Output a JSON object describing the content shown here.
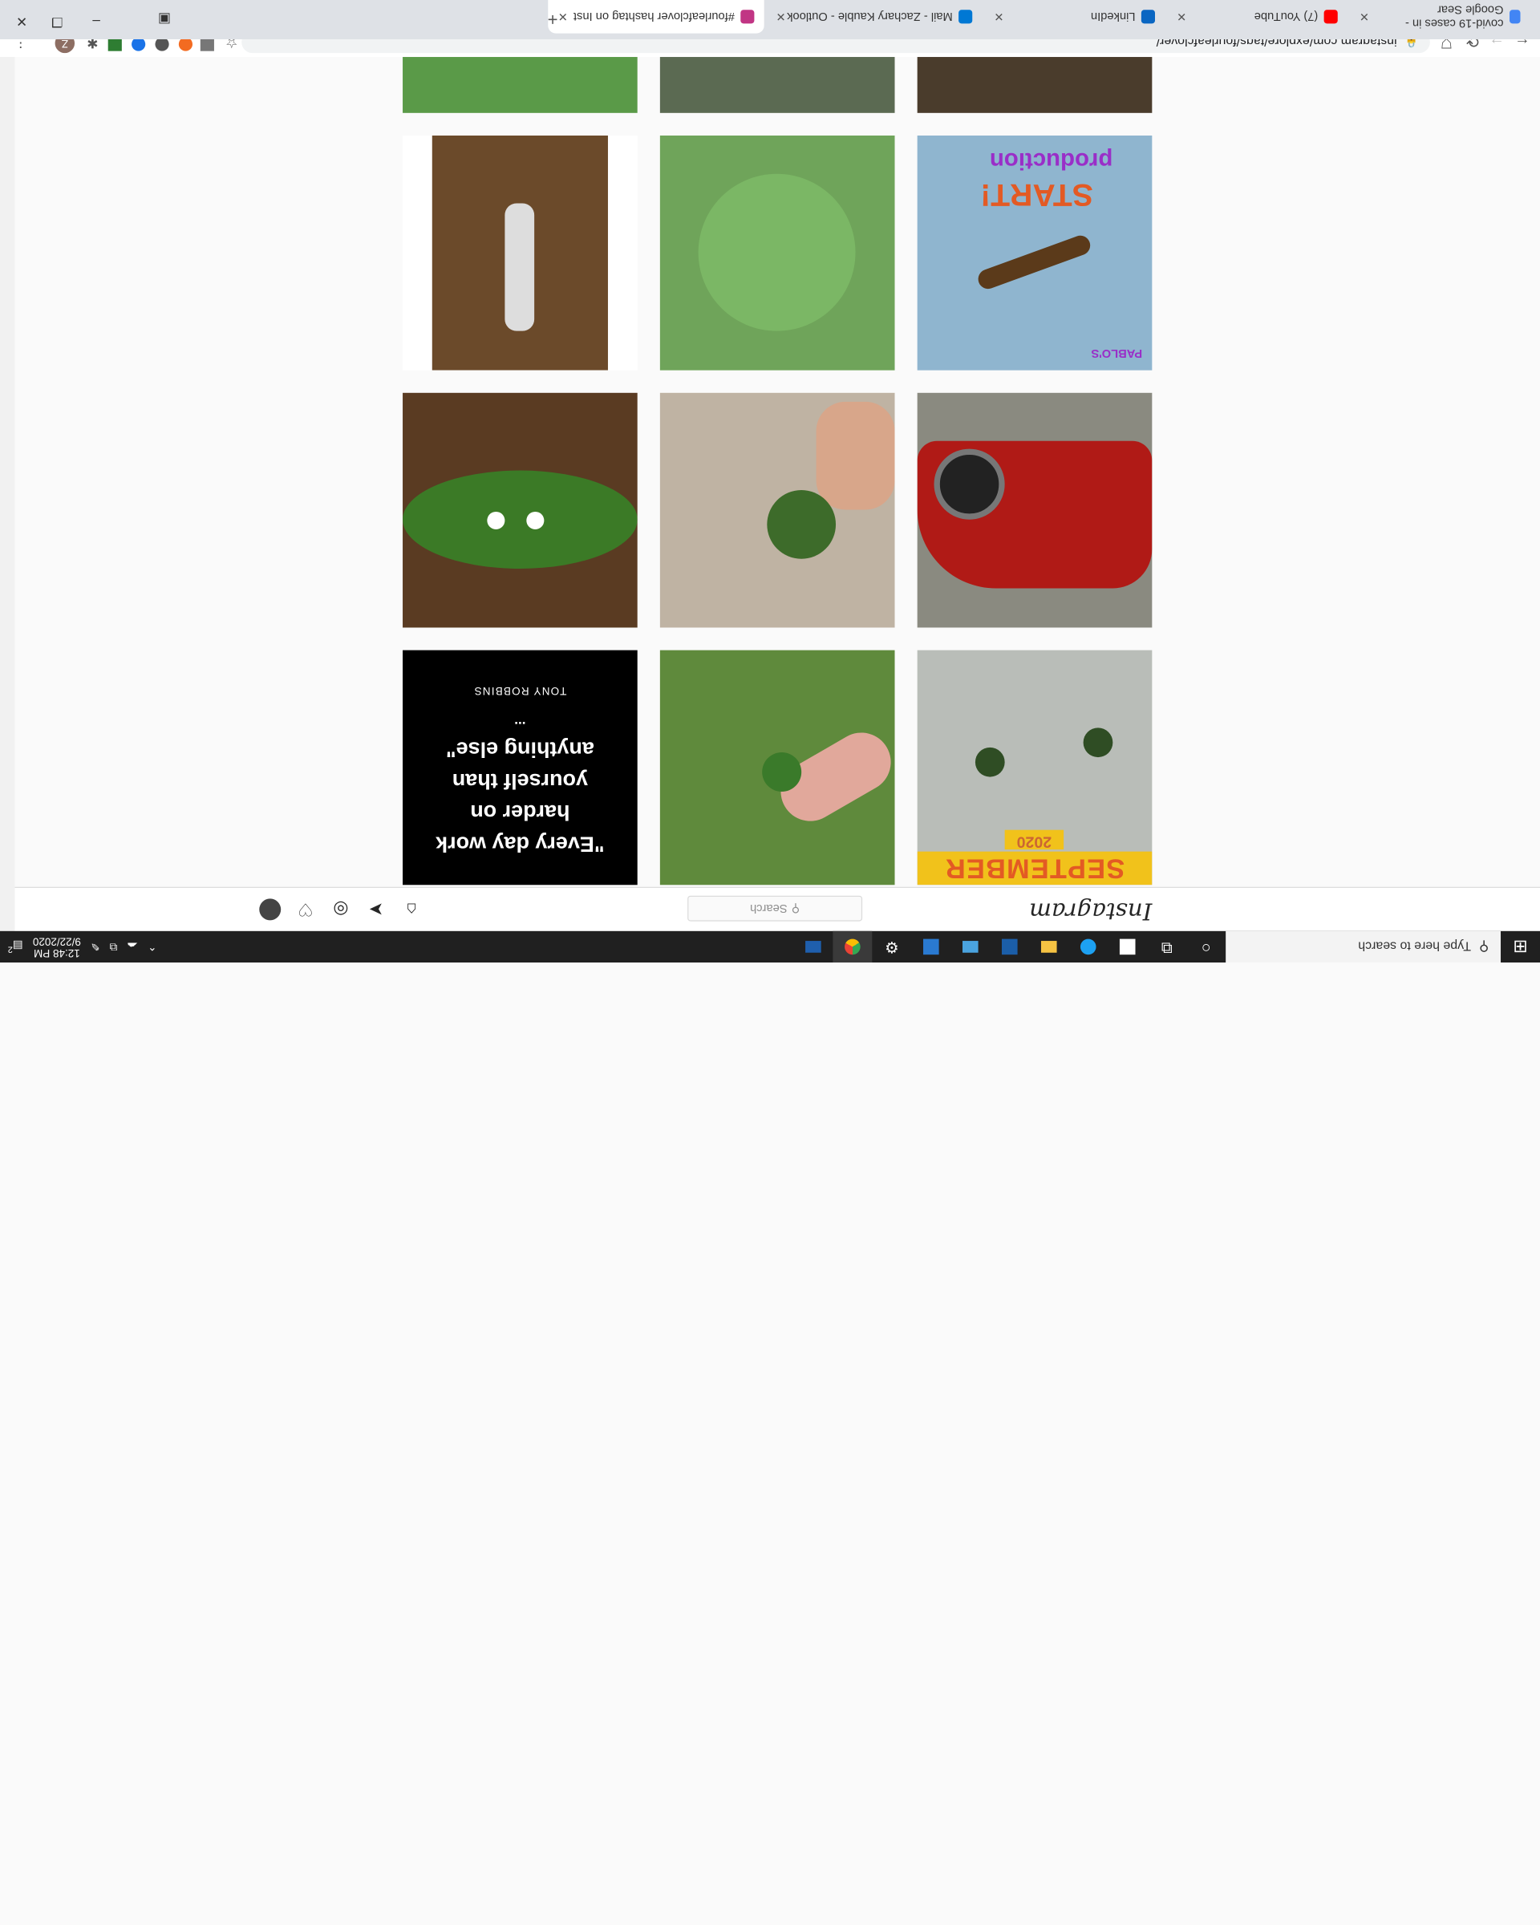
{
  "taskbar": {
    "search_placeholder": "Type here to search",
    "time": "12:48 PM",
    "date": "9/22/2020",
    "notification_count": "2",
    "apps": [
      "cortana-icon",
      "task-view-icon",
      "file-explorer-icon",
      "edge-icon",
      "notes-icon",
      "photoshop-icon",
      "mail-icon",
      "store-icon",
      "settings-icon",
      "chrome-icon",
      "photos-icon"
    ]
  },
  "browser": {
    "tabs": [
      {
        "title": "covid-19 cases in - Google Sear",
        "color": "#4285f4"
      },
      {
        "title": "(7) YouTube",
        "color": "#ff0000"
      },
      {
        "title": "LinkedIn",
        "color": "#0a66c2"
      },
      {
        "title": "Mail - Zachary Kauble - Outlook",
        "color": "#0078d4"
      },
      {
        "title": "#fourleafclover hashtag on Inst",
        "color": "#c13584"
      }
    ],
    "new_tab_symbol": "+",
    "url": "instagram.com/explore/tags/fourleafclover/"
  },
  "instagram": {
    "logo": "Instagram",
    "search_placeholder": "Search"
  },
  "grid": {
    "tiles": [
      {
        "kind": "photo",
        "desc": "September 2020 clovers",
        "bg": "#b9bdb8"
      },
      {
        "kind": "photo",
        "desc": "hand picking clover",
        "bg": "#5f8a3c"
      },
      {
        "kind": "quote",
        "text": "\"Every day work harder on yourself than anything else\"",
        "author": "TONY ROBBINS",
        "dots": "..."
      },
      {
        "kind": "photo",
        "desc": "red car",
        "bg": "#b01a16"
      },
      {
        "kind": "photo",
        "desc": "four leaf clover in fingers",
        "bg": "#bfb3a3"
      },
      {
        "kind": "photo",
        "desc": "clover earrings on leaf",
        "bg": "#3b7a26"
      },
      {
        "kind": "photo",
        "desc": "Start production",
        "bg": "#8fb5cf"
      },
      {
        "kind": "photo",
        "desc": "clover close-up",
        "bg": "#6fa45a"
      },
      {
        "kind": "photo",
        "desc": "person on spiral staircase",
        "bg": "#6b4a2a"
      }
    ],
    "start_text": "START!",
    "production_text": "production",
    "september_text": "SEPTEMBER",
    "year_text": "2020",
    "pablo_text": "PABLO'S"
  }
}
